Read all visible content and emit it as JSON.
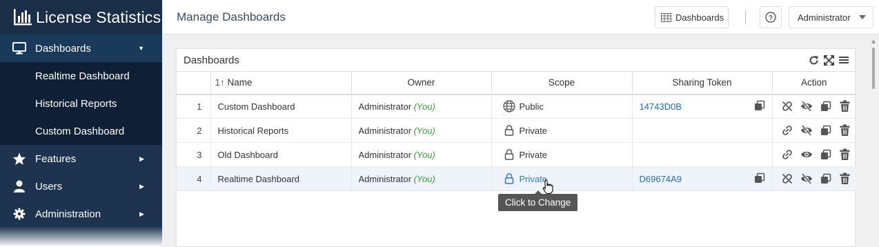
{
  "app": {
    "title": "License Statistics"
  },
  "sidebar": {
    "items": [
      {
        "label": "Dashboards",
        "icon": "monitor-icon",
        "open": true
      },
      {
        "label": "Features",
        "icon": "star-icon"
      },
      {
        "label": "Users",
        "icon": "user-icon"
      },
      {
        "label": "Administration",
        "icon": "gear-icon"
      }
    ],
    "sub_items": [
      "Realtime Dashboard",
      "Historical Reports",
      "Custom Dashboard"
    ]
  },
  "header": {
    "page_title": "Manage Dashboards",
    "dashboards_button": "Dashboards",
    "user_menu": "Administrator"
  },
  "panel": {
    "title": "Dashboards",
    "columns": [
      "",
      "Name",
      "Owner",
      "Scope",
      "Sharing Token",
      "Action"
    ],
    "sort_indicator": "1↑",
    "rows": [
      {
        "index": "1",
        "name": "Custom Dashboard",
        "owner": "Administrator",
        "owner_tag": "(You)",
        "scope": "Public",
        "scope_icon": "globe-icon",
        "token": "14743D0B",
        "link_icon": "unlink-icon",
        "view_icon": "eye-slash-icon"
      },
      {
        "index": "2",
        "name": "Historical Reports",
        "owner": "Administrator",
        "owner_tag": "(You)",
        "scope": "Private",
        "scope_icon": "lock-icon",
        "token": "",
        "link_icon": "link-icon",
        "view_icon": "eye-slash-icon"
      },
      {
        "index": "3",
        "name": "Old Dashboard",
        "owner": "Administrator",
        "owner_tag": "(You)",
        "scope": "Private",
        "scope_icon": "lock-icon",
        "token": "",
        "link_icon": "link-icon",
        "view_icon": "eye-icon"
      },
      {
        "index": "4",
        "name": "Realtime Dashboard",
        "owner": "Administrator",
        "owner_tag": "(You)",
        "scope": "Private",
        "scope_icon": "lock-icon",
        "token": "D69674A9",
        "link_icon": "unlink-icon",
        "view_icon": "eye-slash-icon"
      }
    ]
  },
  "tooltip": {
    "text": "Click to Change"
  },
  "colors": {
    "sidebar": "#1d3350",
    "accent_link": "#2a6aa8",
    "you_green": "#3c9a3c"
  }
}
